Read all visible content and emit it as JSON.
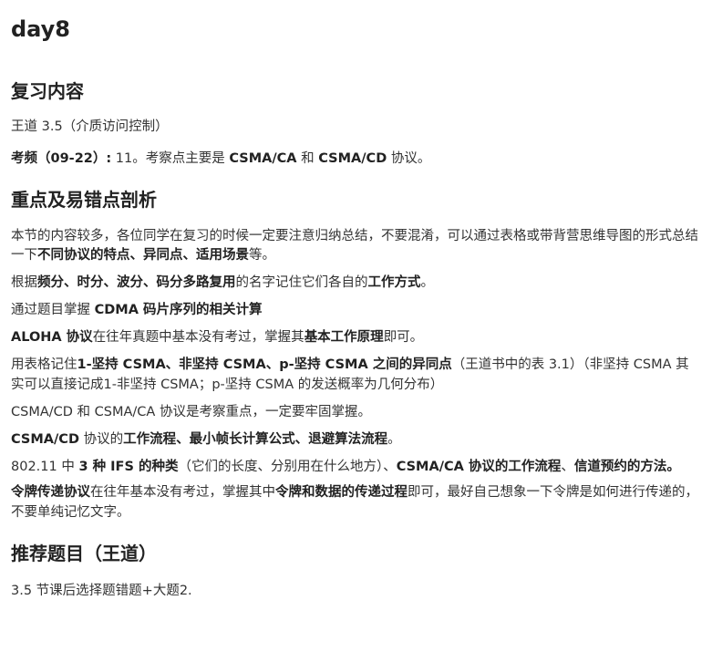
{
  "title": "day8",
  "sections": {
    "review": {
      "heading": "复习内容",
      "line1": "王道 3.5（介质访问控制）",
      "freq_label": "考频（09-22）:",
      "freq_count": " 11。考察点主要是 ",
      "freq_b1": "CSMA/CA",
      "freq_mid": " 和 ",
      "freq_b2": "CSMA/CD",
      "freq_end": " 协议。"
    },
    "key_points": {
      "heading": "重点及易错点剖析",
      "p1_a": "本节的内容较多，各位同学在复习的时候一定要注意归纳总结，不要混淆，可以通过表格或带背营思维导图的形式总结一下",
      "p1_b": "不同协议的特点、异同点、适用场景",
      "p1_c": "等。",
      "p2_a": "根据",
      "p2_b": "频分、时分、波分、码分多路复用",
      "p2_c": "的名字记住它们各自的",
      "p2_d": "工作方式",
      "p2_e": "。",
      "p3_a": "通过题目掌握 ",
      "p3_b": "CDMA 码片序列的相关计算",
      "p4_a": "ALOHA 协议",
      "p4_b": "在往年真题中基本没有考过，掌握其",
      "p4_c": "基本工作原理",
      "p4_d": "即可。",
      "p5_a": "用表格记住",
      "p5_b": "1-坚持 CSMA、非坚持 CSMA、p-坚持 CSMA 之间的异同点",
      "p5_c": "（王道书中的表 3.1）（非坚持 CSMA 其实可以直接记成1-非坚持 CSMA；p-坚持 CSMA 的发送概率为几何分布）",
      "p6": "CSMA/CD 和 CSMA/CA 协议是考察重点，一定要牢固掌握。",
      "p7_a": "CSMA/CD",
      "p7_b": " 协议的",
      "p7_c": "工作流程、最小帧长计算公式、退避算法流程",
      "p7_d": "。",
      "p8_a": "802.11 中 ",
      "p8_b": "3 种 IFS 的种类",
      "p8_c": "（它们的长度、分别用在什么地方）、",
      "p8_d": "CSMA/CA 协议的工作流程",
      "p8_e": "、",
      "p8_f": "信道预约的方法。",
      "p9_a": "令牌传递协议",
      "p9_b": "在往年基本没有考过，掌握其中",
      "p9_c": "令牌和数据的传递过程",
      "p9_d": "即可，最好自己想象一下令牌是如何进行传递的，不要单纯记忆文字。"
    },
    "recommended": {
      "heading": "推荐题目（王道）",
      "line1": "3.5 节课后选择题错题+大题2."
    }
  }
}
